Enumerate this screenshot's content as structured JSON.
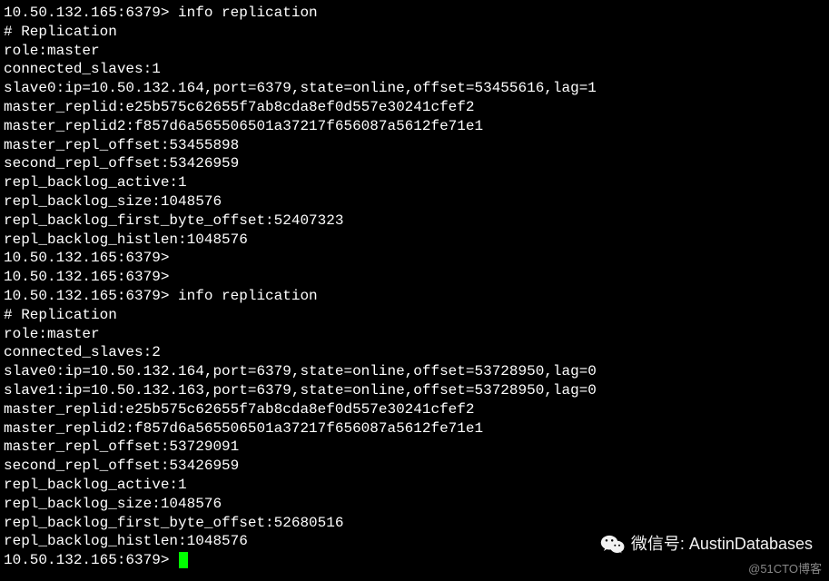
{
  "terminal": {
    "lines": [
      {
        "prompt": "10.50.132.165:6379> ",
        "text": "info replication"
      },
      {
        "text": "# Replication"
      },
      {
        "text": "role:master"
      },
      {
        "text": "connected_slaves:1"
      },
      {
        "text": "slave0:ip=10.50.132.164,port=6379,state=online,offset=53455616,lag=1"
      },
      {
        "text": "master_replid:e25b575c62655f7ab8cda8ef0d557e30241cfef2"
      },
      {
        "text": "master_replid2:f857d6a565506501a37217f656087a5612fe71e1"
      },
      {
        "text": "master_repl_offset:53455898"
      },
      {
        "text": "second_repl_offset:53426959"
      },
      {
        "text": "repl_backlog_active:1"
      },
      {
        "text": "repl_backlog_size:1048576"
      },
      {
        "text": "repl_backlog_first_byte_offset:52407323"
      },
      {
        "text": "repl_backlog_histlen:1048576"
      },
      {
        "prompt": "10.50.132.165:6379> ",
        "text": ""
      },
      {
        "prompt": "10.50.132.165:6379> ",
        "text": ""
      },
      {
        "prompt": "10.50.132.165:6379> ",
        "text": "info replication"
      },
      {
        "text": "# Replication"
      },
      {
        "text": "role:master"
      },
      {
        "text": "connected_slaves:2"
      },
      {
        "text": "slave0:ip=10.50.132.164,port=6379,state=online,offset=53728950,lag=0"
      },
      {
        "text": "slave1:ip=10.50.132.163,port=6379,state=online,offset=53728950,lag=0"
      },
      {
        "text": "master_replid:e25b575c62655f7ab8cda8ef0d557e30241cfef2"
      },
      {
        "text": "master_replid2:f857d6a565506501a37217f656087a5612fe71e1"
      },
      {
        "text": "master_repl_offset:53729091"
      },
      {
        "text": "second_repl_offset:53426959"
      },
      {
        "text": "repl_backlog_active:1"
      },
      {
        "text": "repl_backlog_size:1048576"
      },
      {
        "text": "repl_backlog_first_byte_offset:52680516"
      },
      {
        "text": "repl_backlog_histlen:1048576"
      },
      {
        "prompt": "10.50.132.165:6379> ",
        "text": "",
        "cursor": true
      }
    ]
  },
  "watermark": {
    "wechat_label": "微信号: AustinDatabases",
    "bottom_label": "@51CTO博客"
  }
}
